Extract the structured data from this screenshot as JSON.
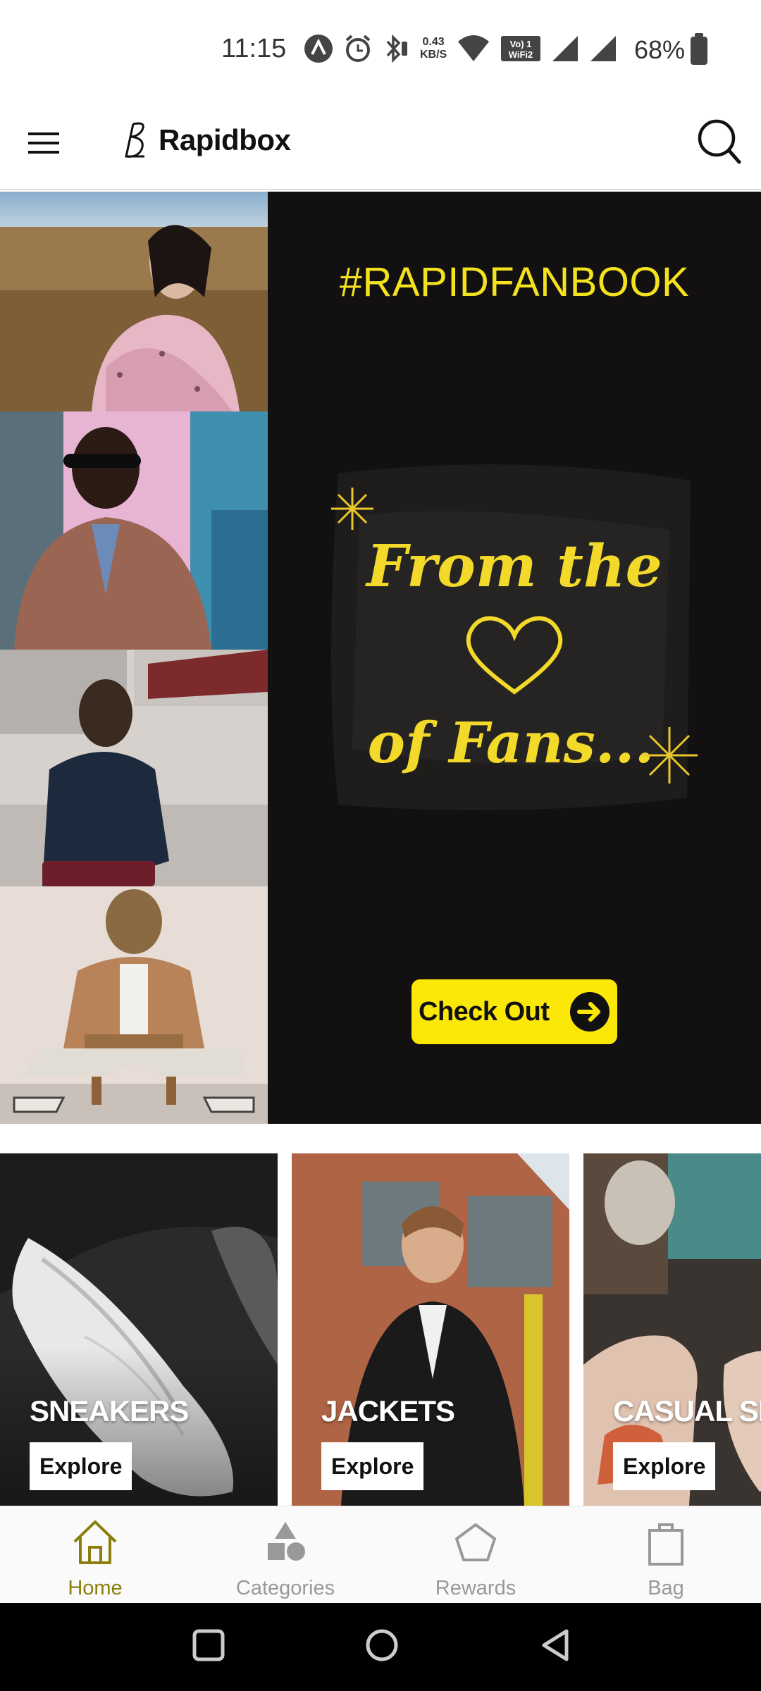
{
  "status_bar": {
    "time": "11:15",
    "net_speed_value": "0.43",
    "net_speed_unit": "KB/S",
    "battery_percent": "68%"
  },
  "app_bar": {
    "brand_name": "Rapidbox",
    "icons": [
      "menu-icon",
      "brand-logo-icon",
      "search-icon"
    ]
  },
  "hero": {
    "hashtag": "#RAPIDFANBOOK",
    "script_line1": "From the",
    "script_line2": "of Fans...",
    "cta_label": "Check Out",
    "colors": {
      "accent_yellow": "#FBE809",
      "background": "#121010"
    }
  },
  "categories": [
    {
      "title": "SNEAKERS",
      "button": "Explore"
    },
    {
      "title": "JACKETS",
      "button": "Explore"
    },
    {
      "title": "CASUAL SI",
      "button": "Explore"
    }
  ],
  "bottom_nav": {
    "items": [
      {
        "label": "Home",
        "icon": "home-icon",
        "active": true
      },
      {
        "label": "Categories",
        "icon": "categories-icon",
        "active": false
      },
      {
        "label": "Rewards",
        "icon": "rewards-icon",
        "active": false
      },
      {
        "label": "Bag",
        "icon": "bag-icon",
        "active": false
      }
    ],
    "active_color": "#8A7E0C"
  },
  "system_nav": {
    "icons": [
      "recents-icon",
      "home-circle-icon",
      "back-icon"
    ]
  }
}
